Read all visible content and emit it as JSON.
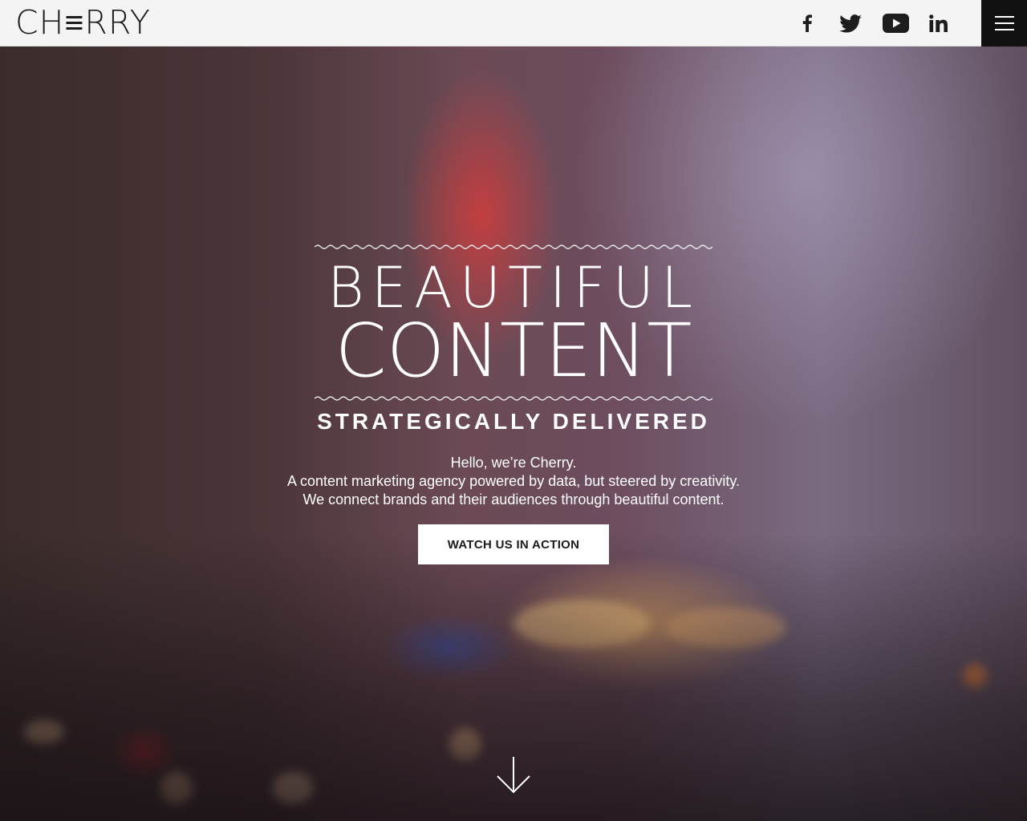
{
  "header": {
    "logo_text": "CH≡RRY",
    "social": [
      "facebook-icon",
      "twitter-icon",
      "youtube-icon",
      "linkedin-icon"
    ],
    "menu_icon": "hamburger-icon"
  },
  "hero": {
    "headline_line1": "BEAUTIFUL",
    "headline_line2": "CONTENT",
    "subheadline": "STRATEGICALLY DELIVERED",
    "intro_line1": "Hello, we’re Cherry.",
    "intro_line2": "A content marketing agency powered by data, but steered by creativity.",
    "intro_line3": "We connect brands and their audiences through beautiful content.",
    "cta_label": "WATCH US IN ACTION",
    "scroll_icon": "arrow-down-icon"
  },
  "colors": {
    "header_bg": "#f4f4f4",
    "menu_bg": "#111111",
    "text_light": "#ffffff",
    "cta_bg": "#ffffff"
  }
}
